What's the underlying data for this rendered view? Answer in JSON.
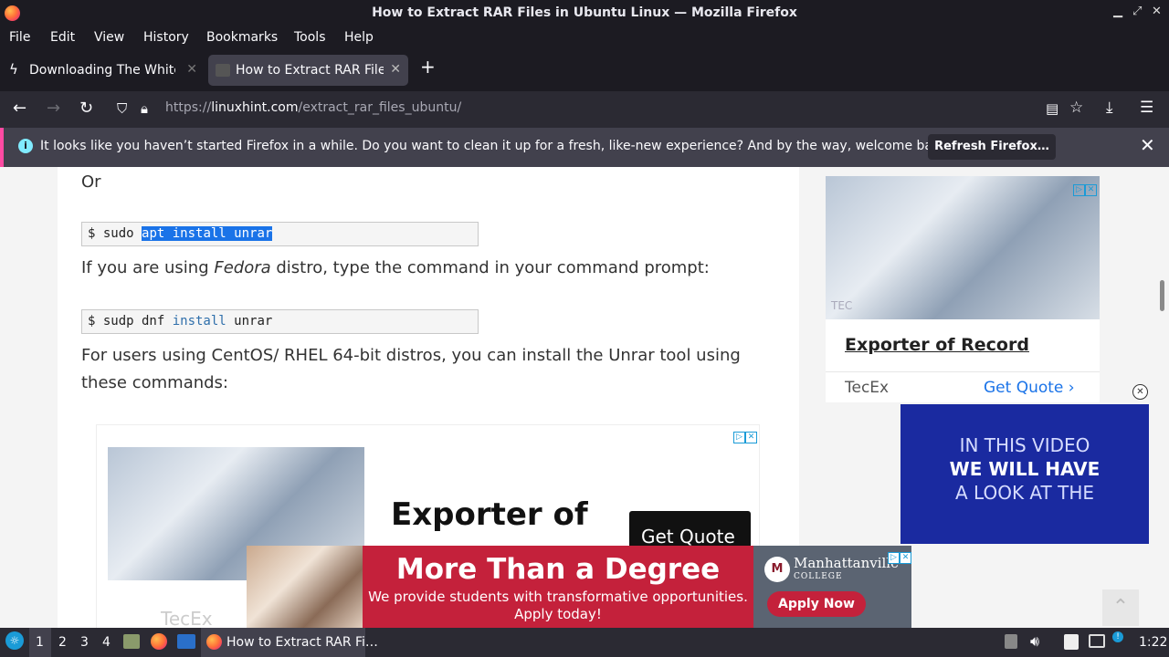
{
  "window": {
    "title": "How to Extract RAR Files in Ubuntu Linux — Mozilla Firefox"
  },
  "menu": [
    "File",
    "Edit",
    "View",
    "History",
    "Bookmarks",
    "Tools",
    "Help"
  ],
  "tabs": [
    {
      "label": "Downloading The White I",
      "active": false
    },
    {
      "label": "How to Extract RAR Files",
      "active": true
    }
  ],
  "urlbar": {
    "prefix": "https://",
    "domain": "linuxhint.com",
    "path": "/extract_rar_files_ubuntu/"
  },
  "notification": {
    "message": "It looks like you haven’t started Firefox in a while. Do you want to clean it up for a fresh, like-new experience? And by the way, welcome back!",
    "button": "Refresh Firefox…"
  },
  "article": {
    "or_text": "Or",
    "cmd1_prompt": "$ sudo ",
    "cmd1_selected": "apt install unrar",
    "fedora_pre": "If you are using ",
    "fedora_em": "Fedora",
    "fedora_post": " distro, type the command in your command prompt:",
    "cmd2_pre": "$ sudp dnf ",
    "cmd2_kw": "install",
    "cmd2_post": " unrar",
    "centos_text": "For users using CentOS/ RHEL 64-bit distros, you can install the Unrar tool using these commands:"
  },
  "inline_ad": {
    "headline": "Exporter of",
    "cta": "Get Quote",
    "brand": "TecEx"
  },
  "sidebar_ad": {
    "headline": "Exporter of Record",
    "brand": "TecEx",
    "cta": "Get Quote",
    "logo": "TEC"
  },
  "video_ad": {
    "line1": "IN THIS VIDEO",
    "line2": "WE WILL HAVE",
    "line3": "A LOOK AT THE"
  },
  "bottom_ad": {
    "headline": "More Than a Degree",
    "sub1": "We provide students with transformative opportunities.",
    "sub2": "Apply today!",
    "school": "Manhattanville",
    "school_sub": "COLLEGE",
    "cta": "Apply Now"
  },
  "taskbar": {
    "workspaces": [
      "1",
      "2",
      "3",
      "4"
    ],
    "window_label": "How to Extract RAR Fi…",
    "clock": "1:22"
  }
}
